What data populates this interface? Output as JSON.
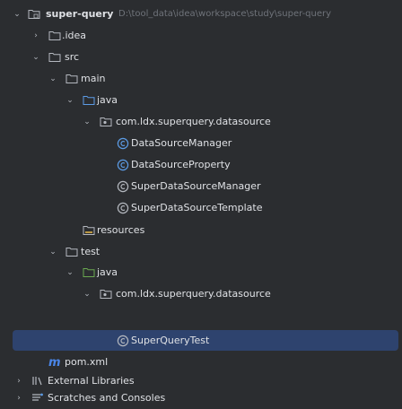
{
  "tree": {
    "root": {
      "label": "super-query",
      "path": "D:\\tool_data\\idea\\workspace\\study\\super-query"
    },
    "idea": "idea",
    "src": "src",
    "main": "main",
    "main_java": "java",
    "main_package": "com.ldx.superquery.datasource",
    "classes": [
      "DataSourceManager",
      "DataSourceProperty",
      "SuperDataSourceManager",
      "SuperDataSourceTemplate"
    ],
    "resources": "resources",
    "test": "test",
    "test_java": "java",
    "test_package": "com.ldx.superquery.datasource",
    "test_class": "SuperQueryTest",
    "pom": "pom.xml",
    "external_libraries": "External Libraries",
    "scratches": "Scratches and Consoles"
  },
  "colors": {
    "background": "#2b2d30",
    "selection": "#2e436e",
    "text": "#dfe1e5",
    "path": "#6f737a",
    "class_icon": "#5c9ce6",
    "pom_icon": "#4a86e8"
  },
  "icons": {
    "folder": "folder-icon",
    "source_folder": "source-folder-icon",
    "package": "package-icon",
    "class": "class-icon",
    "maven": "maven-icon",
    "library": "library-icon",
    "scratches": "scratches-icon"
  }
}
